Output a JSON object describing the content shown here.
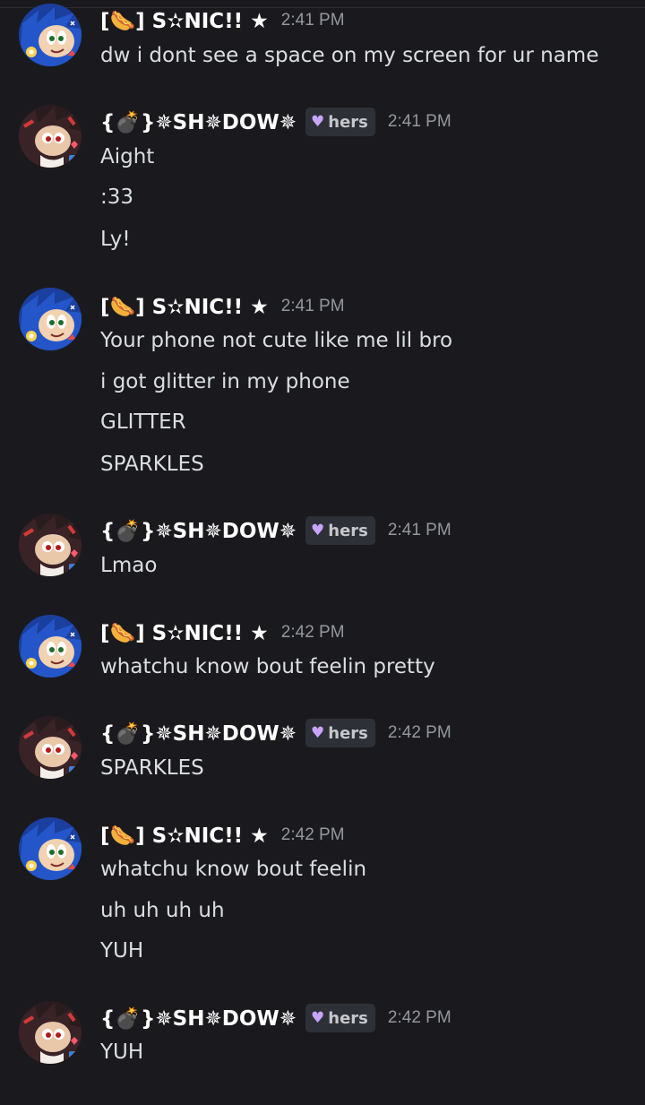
{
  "users": {
    "sonic": "[🌭] S✫NIC!! ★",
    "shadow": "{💣}✵SH✵DOW✵"
  },
  "pronoun_label": "hers",
  "icons": {
    "pronoun": "heart-icon",
    "sonic_avatar": "blue-hedgehog-avatar",
    "shadow_avatar": "black-hedgehog-avatar"
  },
  "colors": {
    "background": "#1a1a1e",
    "username": "#ffffff",
    "message_text": "#dbdee1",
    "timestamp": "#94979e",
    "pronoun_tag_bg": "#2e3037",
    "heart": "#c9a4ff"
  },
  "messages": [
    {
      "user": "sonic",
      "time": "2:41 PM",
      "pronoun": false,
      "lines": [
        "dw i dont see a space on my screen for ur name"
      ]
    },
    {
      "user": "shadow",
      "time": "2:41 PM",
      "pronoun": true,
      "lines": [
        "Aight",
        ":33",
        "Ly!"
      ]
    },
    {
      "user": "sonic",
      "time": "2:41 PM",
      "pronoun": false,
      "lines": [
        "Your phone not cute like me lil bro",
        "i got glitter in my phone",
        "GLITTER",
        "SPARKLES"
      ]
    },
    {
      "user": "shadow",
      "time": "2:41 PM",
      "pronoun": true,
      "lines": [
        "Lmao"
      ]
    },
    {
      "user": "sonic",
      "time": "2:42 PM",
      "pronoun": false,
      "lines": [
        "whatchu know bout feelin pretty"
      ]
    },
    {
      "user": "shadow",
      "time": "2:42 PM",
      "pronoun": true,
      "lines": [
        "SPARKLES"
      ]
    },
    {
      "user": "sonic",
      "time": "2:42 PM",
      "pronoun": false,
      "lines": [
        "whatchu know bout feelin",
        "uh uh uh uh",
        "YUH"
      ]
    },
    {
      "user": "shadow",
      "time": "2:42 PM",
      "pronoun": true,
      "lines": [
        "YUH"
      ]
    }
  ]
}
